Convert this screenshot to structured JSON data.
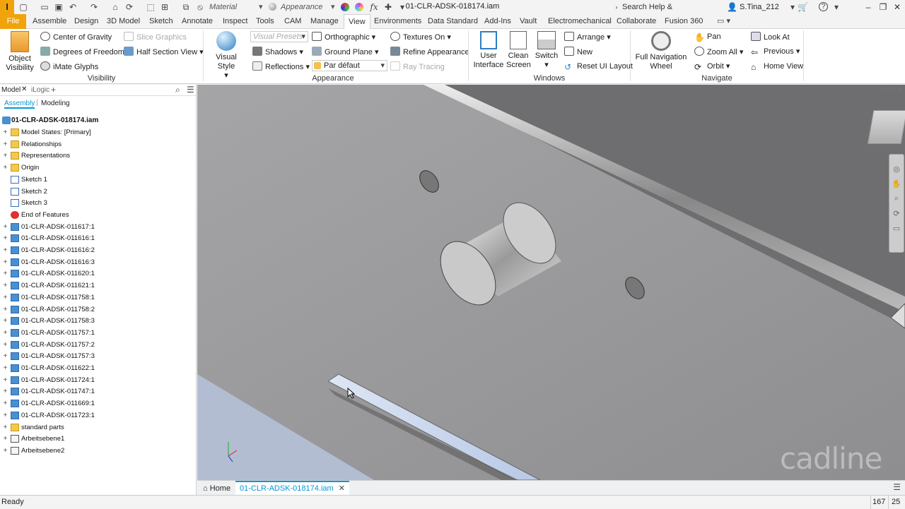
{
  "titlebar": {
    "material": "Material",
    "appearance": "Appearance",
    "doc_title": "01-CLR-ADSK-018174.iam",
    "search": "Search Help & Commands...",
    "user": "S.Tina_212"
  },
  "menu": {
    "file": "File",
    "tabs": [
      "Assemble",
      "Design",
      "3D Model",
      "Sketch",
      "Annotate",
      "Inspect",
      "Tools",
      "CAM",
      "Manage",
      "View",
      "Environments",
      "Data Standard",
      "Add-Ins",
      "Vault",
      "Electromechanical",
      "Collaborate",
      "Fusion 360"
    ],
    "active": "View"
  },
  "ribbon": {
    "visibility": {
      "object_visibility": "Object\nVisibility",
      "center_of_gravity": "Center of Gravity",
      "degrees_of_freedom": "Degrees of Freedom",
      "imate_glyphs": "iMate Glyphs",
      "slice_graphics": "Slice Graphics",
      "half_section_view": "Half Section View",
      "label": "Visibility"
    },
    "appearance": {
      "visual_style": "Visual Style",
      "visual_presets": "Visual Presets",
      "shadows": "Shadows",
      "reflections": "Reflections",
      "orthographic": "Orthographic",
      "ground_plane": "Ground Plane",
      "par_defaut": "Par défaut",
      "textures_on": "Textures On",
      "refine_appearance": "Refine Appearance",
      "ray_tracing": "Ray Tracing",
      "label": "Appearance"
    },
    "windows": {
      "user_interface": "User\nInterface",
      "clean_screen": "Clean\nScreen",
      "switch": "Switch",
      "arrange": "Arrange",
      "new": "New",
      "reset_ui_layout": "Reset UI Layout",
      "label": "Windows"
    },
    "navigate": {
      "full_navigation_wheel": "Full Navigation\nWheel",
      "pan": "Pan",
      "zoom_all": "Zoom All",
      "orbit": "Orbit",
      "look_at": "Look At",
      "previous": "Previous",
      "home_view": "Home View",
      "label": "Navigate"
    }
  },
  "browser": {
    "tab_model": "Model",
    "tab_ilogic": "iLogic",
    "sub_assembly": "Assembly",
    "sub_modeling": "Modeling",
    "root": "01-CLR-ADSK-018174.iam",
    "items": [
      {
        "label": "Model States: [Primary]",
        "icon": "folder"
      },
      {
        "label": "Relationships",
        "icon": "folder"
      },
      {
        "label": "Representations",
        "icon": "folder"
      },
      {
        "label": "Origin",
        "icon": "folder"
      },
      {
        "label": "Sketch 1",
        "icon": "sketch"
      },
      {
        "label": "Sketch 2",
        "icon": "sketch"
      },
      {
        "label": "Sketch 3",
        "icon": "sketch"
      },
      {
        "label": "End of Features",
        "icon": "end"
      },
      {
        "label": "01-CLR-ADSK-011617:1",
        "icon": "part"
      },
      {
        "label": "01-CLR-ADSK-011616:1",
        "icon": "part"
      },
      {
        "label": "01-CLR-ADSK-011616:2",
        "icon": "part"
      },
      {
        "label": "01-CLR-ADSK-011616:3",
        "icon": "part"
      },
      {
        "label": "01-CLR-ADSK-011620:1",
        "icon": "part"
      },
      {
        "label": "01-CLR-ADSK-011621:1",
        "icon": "part"
      },
      {
        "label": "01-CLR-ADSK-011758:1",
        "icon": "part"
      },
      {
        "label": "01-CLR-ADSK-011758:2",
        "icon": "part"
      },
      {
        "label": "01-CLR-ADSK-011758:3",
        "icon": "part"
      },
      {
        "label": "01-CLR-ADSK-011757:1",
        "icon": "part"
      },
      {
        "label": "01-CLR-ADSK-011757:2",
        "icon": "part"
      },
      {
        "label": "01-CLR-ADSK-011757:3",
        "icon": "part"
      },
      {
        "label": "01-CLR-ADSK-011622:1",
        "icon": "part"
      },
      {
        "label": "01-CLR-ADSK-011724:1",
        "icon": "part"
      },
      {
        "label": "01-CLR-ADSK-011747:1",
        "icon": "part"
      },
      {
        "label": "01-CLR-ADSK-011669:1",
        "icon": "part"
      },
      {
        "label": "01-CLR-ADSK-011723:1",
        "icon": "part"
      },
      {
        "label": "standard parts",
        "icon": "folder"
      },
      {
        "label": "Arbeitsebene1",
        "icon": "plane"
      },
      {
        "label": "Arbeitsebene2",
        "icon": "plane"
      }
    ]
  },
  "doctabs": {
    "home": "Home",
    "active": "01-CLR-ADSK-018174.iam"
  },
  "status": {
    "text": "Ready",
    "num1": "167",
    "num2": "25"
  },
  "watermark": "cadline",
  "colors": {
    "accent": "#f0a30a",
    "link": "#0696d7"
  }
}
